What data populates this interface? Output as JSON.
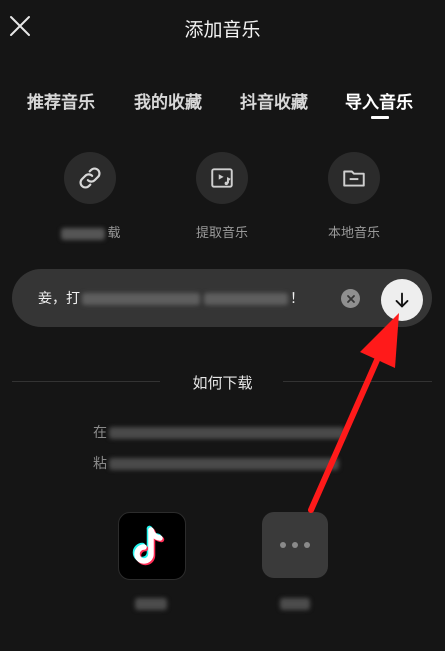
{
  "header": {
    "title": "添加音乐"
  },
  "tabs": [
    {
      "label": "推荐音乐"
    },
    {
      "label": "我的收藏"
    },
    {
      "label": "抖音收藏"
    },
    {
      "label": "导入音乐"
    }
  ],
  "tools": [
    {
      "label_visible": "载",
      "icon": "link-icon"
    },
    {
      "label": "提取音乐",
      "icon": "video-music-icon"
    },
    {
      "label": "本地音乐",
      "icon": "folder-icon"
    }
  ],
  "paste_bar": {
    "prefix": "妾，打",
    "suffix": "！"
  },
  "howto": {
    "title": "如何下载",
    "line1_visible": "在",
    "line2_visible": "粘"
  },
  "apps": [
    {
      "icon": "tiktok-icon"
    },
    {
      "icon": "more-icon"
    }
  ],
  "colors": {
    "background": "#151515",
    "annotation_arrow": "#ff1a1a"
  }
}
